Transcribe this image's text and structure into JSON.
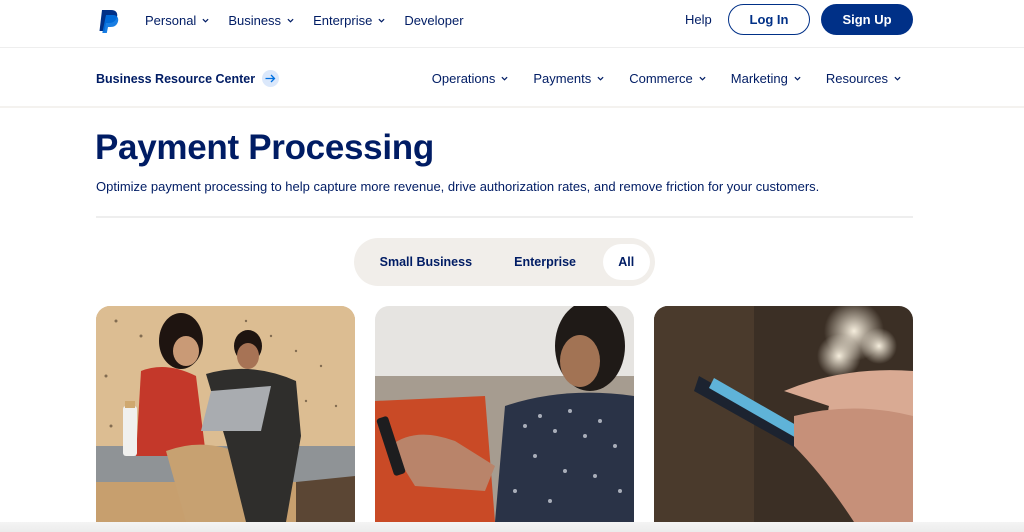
{
  "topnav": {
    "logo": "paypal-logo",
    "links": [
      {
        "label": "Personal",
        "has_dropdown": true
      },
      {
        "label": "Business",
        "has_dropdown": true
      },
      {
        "label": "Enterprise",
        "has_dropdown": true
      },
      {
        "label": "Developer",
        "has_dropdown": false
      }
    ],
    "help_label": "Help",
    "login_label": "Log In",
    "signup_label": "Sign Up"
  },
  "subnav": {
    "resource_center_label": "Business Resource Center",
    "links": [
      {
        "label": "Operations"
      },
      {
        "label": "Payments"
      },
      {
        "label": "Commerce"
      },
      {
        "label": "Marketing"
      },
      {
        "label": "Resources"
      }
    ]
  },
  "hero": {
    "title": "Payment Processing",
    "subtitle": "Optimize payment processing to help capture more revenue, drive authorization rates, and remove friction for your customers."
  },
  "filter": {
    "options": [
      {
        "label": "Small Business",
        "selected": false
      },
      {
        "label": "Enterprise",
        "selected": false
      },
      {
        "label": "All",
        "selected": true
      }
    ]
  },
  "cards": [
    {
      "image": "two-women-laptop-bench"
    },
    {
      "image": "woman-on-couch-with-phone"
    },
    {
      "image": "hand-tapping-smartphone"
    }
  ],
  "colors": {
    "brand_navy": "#001c64",
    "button_blue": "#003087",
    "segment_bg": "#f1eeea",
    "arrow_bg": "#dbe8fb"
  }
}
